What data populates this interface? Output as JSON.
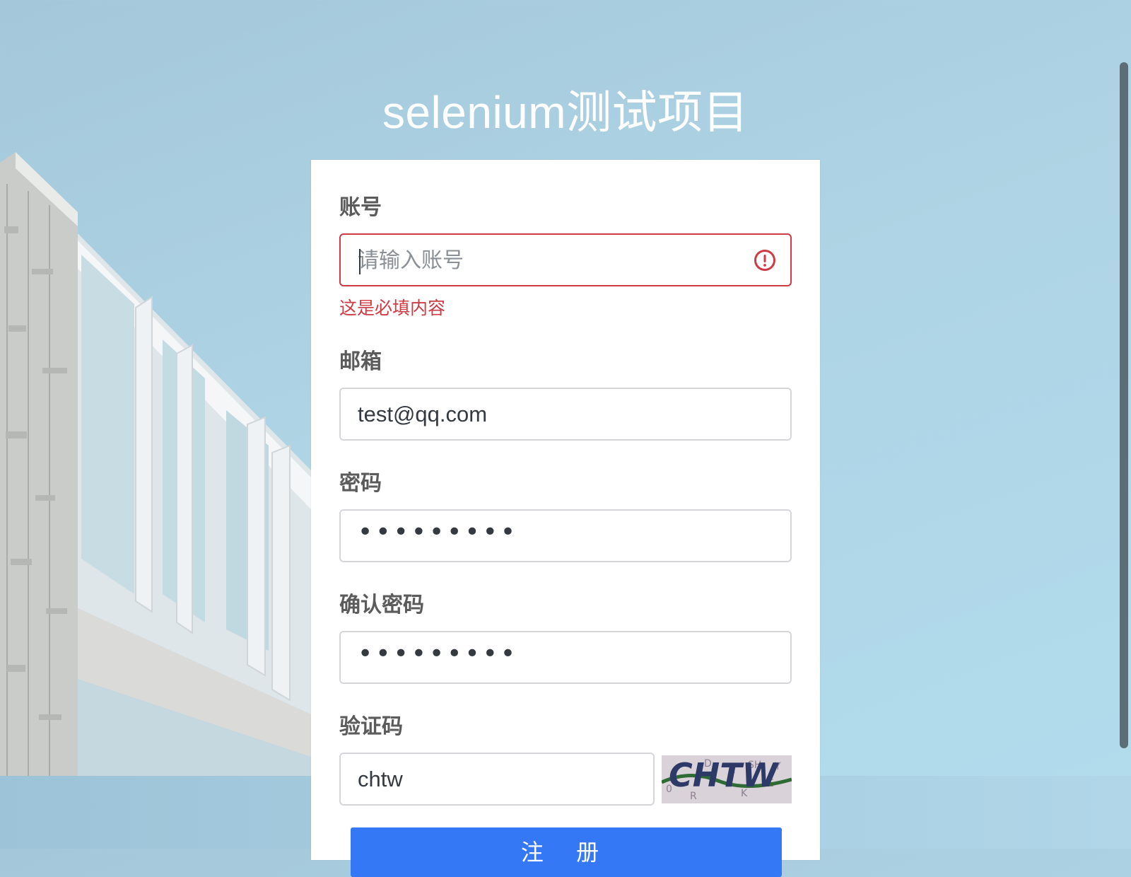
{
  "page": {
    "title": "selenium测试项目"
  },
  "form": {
    "account": {
      "label": "账号",
      "placeholder": "请输入账号",
      "value": "",
      "error": "这是必填内容"
    },
    "email": {
      "label": "邮箱",
      "value": "test@qq.com"
    },
    "password": {
      "label": "密码",
      "masked": "•••••••••"
    },
    "confirm_password": {
      "label": "确认密码",
      "masked": "•••••••••"
    },
    "captcha": {
      "label": "验证码",
      "value": "chtw",
      "image_text": "CHTW"
    },
    "submit_label": "注 册"
  },
  "colors": {
    "primary": "#3478f6",
    "error": "#cd3b45",
    "label": "#5b5b5b"
  }
}
